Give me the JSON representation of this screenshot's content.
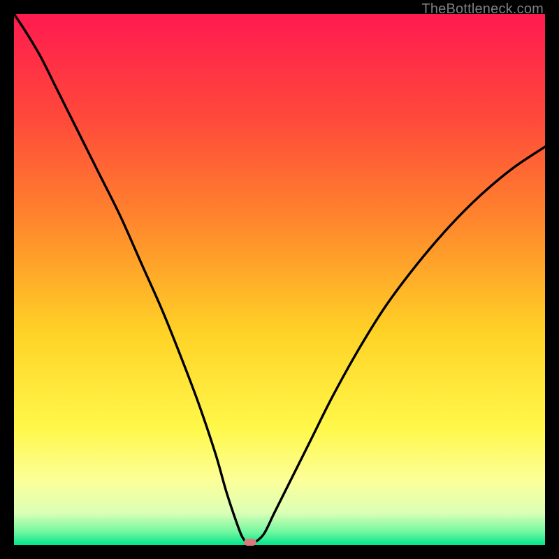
{
  "watermark": "TheBottleneck.com",
  "chart_data": {
    "type": "line",
    "title": "",
    "xlabel": "",
    "ylabel": "",
    "xlim": [
      0,
      100
    ],
    "ylim": [
      0,
      100
    ],
    "grid": false,
    "legend": false,
    "background": {
      "type": "vertical-gradient",
      "stops": [
        {
          "pos": 0.0,
          "color": "#ff1a50"
        },
        {
          "pos": 0.2,
          "color": "#ff4a3a"
        },
        {
          "pos": 0.4,
          "color": "#ff8a2c"
        },
        {
          "pos": 0.6,
          "color": "#ffd226"
        },
        {
          "pos": 0.78,
          "color": "#fff84a"
        },
        {
          "pos": 0.88,
          "color": "#fcff9a"
        },
        {
          "pos": 0.94,
          "color": "#daffb6"
        },
        {
          "pos": 0.975,
          "color": "#73f7a0"
        },
        {
          "pos": 1.0,
          "color": "#00e58a"
        }
      ]
    },
    "series": [
      {
        "name": "bottleneck-curve",
        "color": "#000000",
        "x": [
          0,
          2,
          5,
          8,
          12,
          16,
          20,
          24,
          28,
          32,
          35,
          38,
          40,
          42,
          43,
          44,
          45,
          47,
          49,
          52,
          56,
          60,
          65,
          70,
          76,
          82,
          88,
          94,
          100
        ],
        "y": [
          100,
          97,
          92,
          86,
          78,
          70,
          62,
          53,
          44,
          34,
          26,
          17,
          10,
          4,
          1.5,
          0.3,
          0.3,
          2,
          6,
          12,
          20,
          28,
          37,
          45,
          53,
          60,
          66,
          71,
          75
        ]
      }
    ],
    "marker": {
      "name": "optimum-point",
      "x": 44.5,
      "y": 0,
      "color": "#d87b7b",
      "shape": "rounded-rect"
    }
  }
}
